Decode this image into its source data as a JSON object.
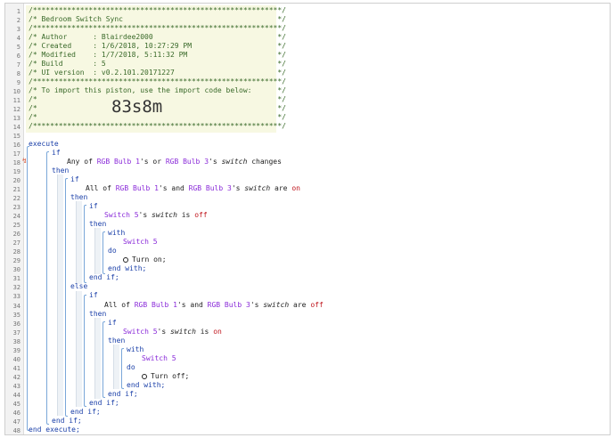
{
  "comment": {
    "lines": [
      "/**********************************************************/",
      "/* Bedroom Switch Sync                                    */",
      "/**********************************************************/",
      "/* Author      : Blairdee2000                             */",
      "/* Created     : 1/6/2018, 10:27:29 PM                    */",
      "/* Modified    : 1/7/2018, 5:11:32 PM                     */",
      "/* Build       : 5                                        */",
      "/* UI version  : v0.2.101.20171227                        */",
      "/**********************************************************/",
      "/* To import this piston, use the import code below:      */",
      "/*                                                        */",
      "/*                                                        */",
      "/*                                                        */",
      "/**********************************************************/"
    ],
    "import_code": "83s8m"
  },
  "code": {
    "execute": "execute",
    "end_execute": "end execute;",
    "if": "if",
    "then": "then",
    "else": "else",
    "with": "with",
    "do": "do",
    "end_if": "end if;",
    "end_with": "end with;",
    "any_of": "Any of",
    "all_of": "All of",
    "device_bulb1": "RGB Bulb 1",
    "device_bulb3": "RGB Bulb 3",
    "device_switch5": "Switch 5",
    "possessive": "'s",
    "or": "or",
    "and": "and",
    "attr_switch": "switch",
    "changes": "changes",
    "are": "are",
    "is": "is",
    "value_on": "on",
    "value_off": "off",
    "turn_on": "Turn on;",
    "turn_off": "Turn off;"
  },
  "line_numbers": [
    "1",
    "2",
    "3",
    "4",
    "5",
    "6",
    "7",
    "8",
    "9",
    "10",
    "11",
    "12",
    "13",
    "14",
    "15",
    "16",
    "17",
    "18",
    "19",
    "20",
    "21",
    "22",
    "23",
    "24",
    "25",
    "26",
    "27",
    "28",
    "29",
    "30",
    "31",
    "32",
    "33",
    "34",
    "35",
    "36",
    "37",
    "38",
    "39",
    "40",
    "41",
    "42",
    "43",
    "44",
    "45",
    "46",
    "47",
    "48"
  ]
}
